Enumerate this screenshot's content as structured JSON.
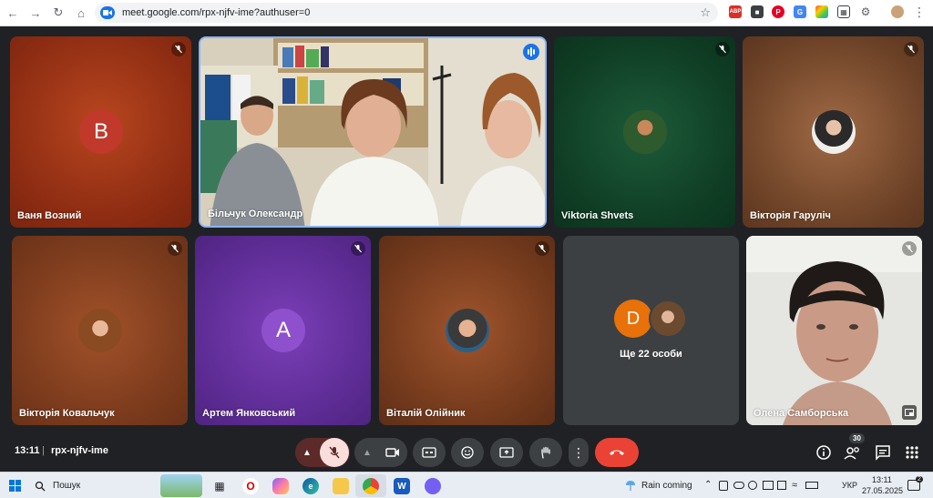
{
  "browser": {
    "url": "meet.google.com/rpx-njfv-ime?authuser=0"
  },
  "tiles": [
    {
      "name": "Ваня Возний",
      "avatar_letter": "B",
      "avatar_color": "#b3261e",
      "muted": true
    },
    {
      "name": "Більчук Олександр",
      "speaking": true
    },
    {
      "name": "Viktoria Shvets",
      "muted": true
    },
    {
      "name": "Вікторія Гаруліч",
      "muted": true
    },
    {
      "name": "Вікторія Ковальчук",
      "muted": true
    },
    {
      "name": "Артем Янковський",
      "avatar_letter": "A",
      "avatar_color": "#7b3fb8",
      "muted": true
    },
    {
      "name": "Віталій Олійник",
      "muted": true
    },
    {
      "avatar_letter": "D",
      "avatar_color": "#e8710a",
      "more_label": "Ще 22 особи"
    },
    {
      "name": "Олена Самборська",
      "muted": true
    }
  ],
  "bottombar": {
    "time": "13:11",
    "separator": "|",
    "meeting_code": "rpx-njfv-ime",
    "participants_count": "30",
    "end_call_color": "#ea4335",
    "mic_off_color": "#f9dedc"
  },
  "taskbar": {
    "search_placeholder": "Пошук",
    "weather": "Rain coming",
    "language": "УКР",
    "clock_time": "13:11",
    "clock_date": "27.05.2025",
    "notifications": "2"
  }
}
